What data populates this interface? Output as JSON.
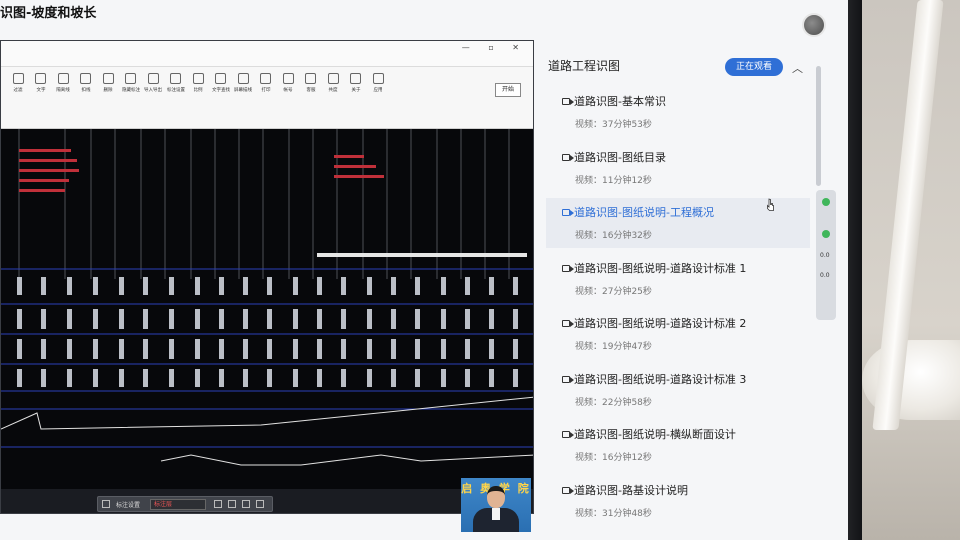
{
  "page": {
    "title": "识图-坡度和坡长"
  },
  "player": {
    "ribbon_tools": [
      "过滤",
      "文字",
      "隔离线",
      "扣线",
      "删除",
      "隐藏标注",
      "导入导出",
      "标注设置",
      "比例",
      "文字查找",
      "屏幕描线",
      "打印",
      "帐号",
      "客服",
      "共度",
      "关于",
      "应用"
    ],
    "open_button": "开始",
    "bottom_toolbar": {
      "label": "标注设置",
      "selected_layer": "标注层"
    },
    "presenter_banner": "启 奥 学 院"
  },
  "course": {
    "title": "道路工程识图",
    "watching_badge": "正在观看",
    "lessons": [
      {
        "title": "道路识图-基本常识",
        "meta": "视频：37分钟53秒",
        "active": false
      },
      {
        "title": "道路识图-图纸目录",
        "meta": "视频：11分钟12秒",
        "active": false
      },
      {
        "title": "道路识图-图纸说明-工程概况",
        "meta": "视频：16分钟32秒",
        "active": true
      },
      {
        "title": "道路识图-图纸说明-道路设计标准 1",
        "meta": "视频：27分钟25秒",
        "active": false
      },
      {
        "title": "道路识图-图纸说明-道路设计标准 2",
        "meta": "视频：19分钟47秒",
        "active": false
      },
      {
        "title": "道路识图-图纸说明-道路设计标准 3",
        "meta": "视频：22分钟58秒",
        "active": false
      },
      {
        "title": "道路识图-图纸说明-横纵断面设计",
        "meta": "视频：16分钟12秒",
        "active": false
      },
      {
        "title": "道路识图-路基设计说明",
        "meta": "视频：31分钟48秒",
        "active": false
      }
    ]
  },
  "widget": {
    "values": [
      "0.0",
      "0.0"
    ]
  },
  "colors": {
    "accent": "#2f6fd6",
    "drawing_bg": "#07080b",
    "status_green": "#3fb65a"
  }
}
